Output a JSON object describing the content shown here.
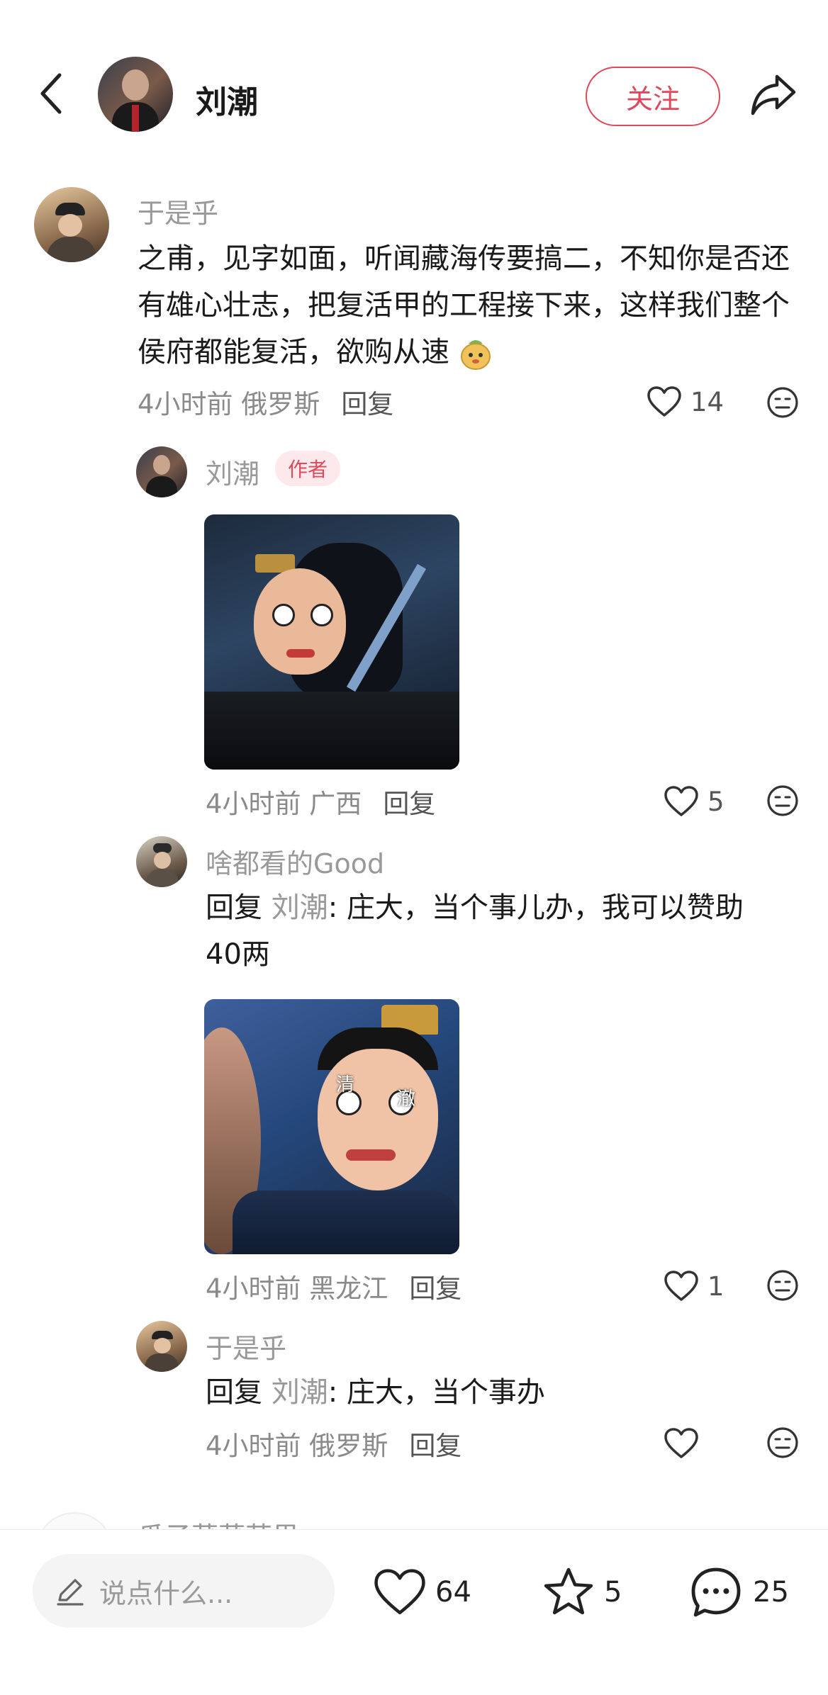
{
  "header": {
    "title": "刘潮",
    "follow_label": "关注"
  },
  "comments": {
    "c1": {
      "user": "于是乎",
      "text": "之甫，见字如面，听闻藏海传要搞二，不知你是否还有雄心壮志，把复活甲的工程接下来，这样我们整个侯府都能复活，欲购从速",
      "meta": "4小时前 俄罗斯",
      "reply_label": "回复",
      "likes": "14"
    },
    "r1": {
      "user": "刘潮",
      "badge": "作者",
      "meta": "4小时前 广西",
      "reply_label": "回复",
      "likes": "5"
    },
    "r2": {
      "user": "啥都看的Good",
      "reply_prefix": "回复",
      "reply_to": "刘潮",
      "text": ": 庄大，当个事儿办，我可以赞助40两",
      "image_caption_left": "清",
      "image_caption_right": "澈",
      "meta": "4小时前 黑龙江",
      "reply_label": "回复",
      "likes": "1"
    },
    "r3": {
      "user": "于是乎",
      "reply_prefix": "回复",
      "reply_to": "刘潮",
      "text": ": 庄大，当个事办",
      "meta": "4小时前 俄罗斯",
      "reply_label": "回复"
    },
    "c2_partial": {
      "user": "瓜子菜菜苹果"
    }
  },
  "bottom_bar": {
    "input_placeholder": "说点什么...",
    "likes": "64",
    "stars": "5",
    "comments": "25"
  },
  "colors": {
    "accent": "#e0485c",
    "meta_gray": "#8a8a8a"
  },
  "icons": [
    "back-icon",
    "share-icon",
    "heart-icon",
    "dislike-face-icon",
    "pencil-icon",
    "star-icon",
    "comment-bubble-icon",
    "emoji-icon"
  ]
}
